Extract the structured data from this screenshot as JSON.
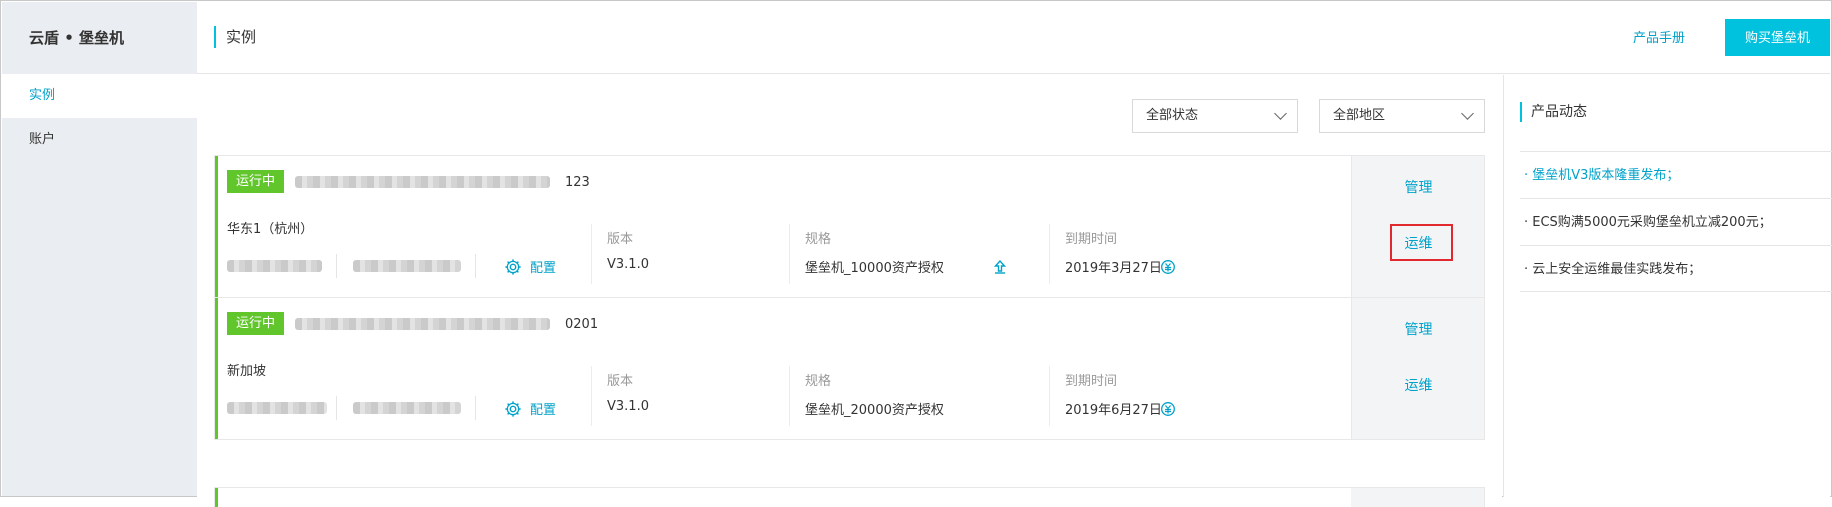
{
  "app": {
    "brand": "云盾 • 堡垒机"
  },
  "sidebar": {
    "items": [
      {
        "label": "实例",
        "active": true
      },
      {
        "label": "账户",
        "active": false
      }
    ]
  },
  "header": {
    "title": "实例",
    "manual_link": "产品手册",
    "buy_button": "购买堡垒机"
  },
  "filters": {
    "status": "全部状态",
    "region": "全部地区"
  },
  "instances": [
    {
      "status": "运行中",
      "name_suffix": "123",
      "region": "华东1（杭州）",
      "config_label": "配置",
      "version_label": "版本",
      "version": "V3.1.0",
      "spec_label": "规格",
      "spec": "堡垒机_10000资产授权",
      "expire_label": "到期时间",
      "expire": "2019年3月27日",
      "manage": "管理",
      "ops": "运维"
    },
    {
      "status": "运行中",
      "name_suffix": "0201",
      "region": "新加坡",
      "config_label": "配置",
      "version_label": "版本",
      "version": "V3.1.0",
      "spec_label": "规格",
      "spec": "堡垒机_20000资产授权",
      "expire_label": "到期时间",
      "expire": "2019年6月27日",
      "manage": "管理",
      "ops": "运维"
    }
  ],
  "news_panel": {
    "title": "产品动态",
    "items": [
      "· 堡垒机V3版本隆重发布；",
      "· ECS购满5000元采购堡垒机立减200元；",
      "· 云上安全运维最佳实践发布；"
    ]
  },
  "colors": {
    "accent": "#00c1de",
    "link": "#00a2ca",
    "running": "#61c62b",
    "highlight_box": "#e0282e"
  }
}
